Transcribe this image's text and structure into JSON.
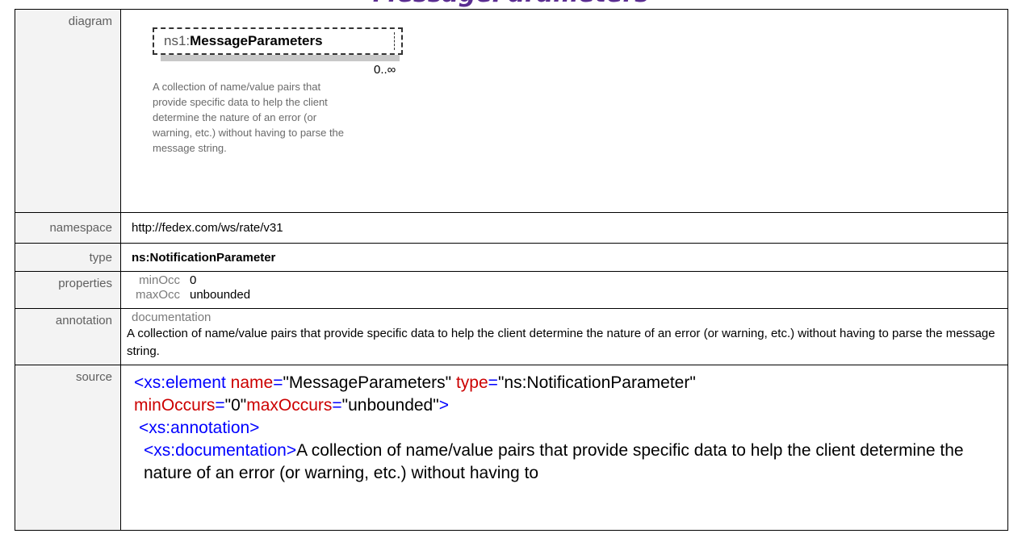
{
  "heading": "MessageParameters",
  "labels": {
    "diagram": "diagram",
    "namespace": "namespace",
    "type": "type",
    "properties": "properties",
    "annotation": "annotation",
    "source": "source"
  },
  "diagram": {
    "prefix": "ns1:",
    "name": "MessageParameters",
    "cardinality": "0..∞",
    "annotation": "A collection of name/value pairs that provide specific data to help the client determine the nature of an error (or warning, etc.) without having to parse the message string."
  },
  "namespace": "http://fedex.com/ws/rate/v31",
  "type": "ns:NotificationParameter",
  "properties": {
    "min_key": "minOcc",
    "min_value": "0",
    "max_key": "maxOcc",
    "max_value": "unbounded"
  },
  "annotation": {
    "heading": "documentation",
    "text": "A collection of name/value pairs that provide specific data to help the client determine the nature of an error (or warning, etc.) without having to parse the message string."
  },
  "source": {
    "line1_tag": "<xs:element",
    "attr_name": "name",
    "attr_name_val": "\"MessageParameters\"",
    "attr_type": "type",
    "attr_type_val": "\"ns:NotificationParameter\"",
    "attr_min": "minOccurs",
    "attr_min_val": "\"0\"",
    "attr_max": "maxOccurs",
    "attr_max_val": "\"unbounded\"",
    "close": ">",
    "eq": "=",
    "annotation_open": "<xs:annotation>",
    "documentation_open": "<xs:documentation>",
    "documentation_text": "A collection of name/value pairs that provide specific data to help the client determine the nature of an error (or warning, etc.) without having to"
  },
  "colors": {
    "heading": "#5a2d91",
    "tag": "#8b0000",
    "attribute": "#cc0000",
    "punctuation": "#0000ff"
  }
}
